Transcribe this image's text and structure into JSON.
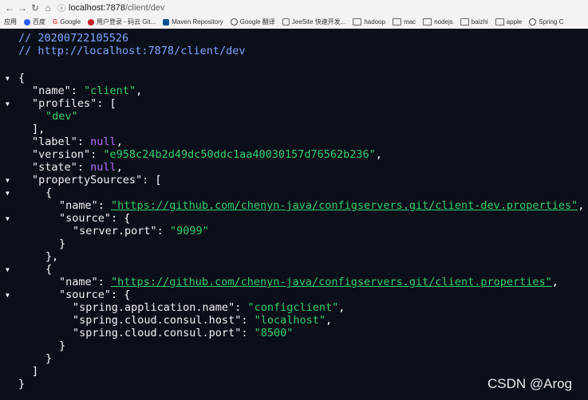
{
  "browser": {
    "url_host": "localhost:7878",
    "url_path": "/client/dev",
    "bookmarks": [
      {
        "label": "应用",
        "icon": "apps-icon"
      },
      {
        "label": "百度",
        "icon": "baidu-icon",
        "color": "#2a5cff"
      },
      {
        "label": "Google",
        "icon": "google-icon",
        "color": "#ea4335"
      },
      {
        "label": "用户登录 - 码云 Git...",
        "icon": "gitee-icon",
        "color": "#c71d23"
      },
      {
        "label": "Maven Repository",
        "icon": "maven-icon",
        "color": "#0b5394"
      },
      {
        "label": "Google 翻译",
        "icon": "translate-icon",
        "color": "#444444"
      },
      {
        "label": "JeeSite 快速开发...",
        "icon": "jeesite-icon",
        "color": "#666666"
      },
      {
        "label": "hadoop",
        "icon": "folder-icon"
      },
      {
        "label": "mac",
        "icon": "folder-icon"
      },
      {
        "label": "nodejs",
        "icon": "folder-icon"
      },
      {
        "label": "baizhi",
        "icon": "folder-icon"
      },
      {
        "label": "apple",
        "icon": "folder-icon"
      },
      {
        "label": "Spring C",
        "icon": "spring-icon",
        "color": "#444444"
      }
    ]
  },
  "json_view": {
    "comment_timestamp": "// 20200722105526",
    "comment_url": "// http://localhost:7878/client/dev",
    "name_value": "\"client\"",
    "profiles_0": "\"dev\"",
    "label_value": "null",
    "version_value": "\"e958c24b2d49dc50ddc1aa40030157d76562b236\"",
    "state_value": "null",
    "ps0_name": "\"https://github.com/chenyn-java/configservers.git/client-dev.properties\"",
    "ps0_key": "\"server.port\"",
    "ps0_val": "\"9099\"",
    "ps1_name": "\"https://github.com/chenyn-java/configservers.git/client.properties\"",
    "ps1_k1": "\"spring.application.name\"",
    "ps1_v1": "\"configclient\"",
    "ps1_k2": "\"spring.cloud.consul.host\"",
    "ps1_v2": "\"localhost\"",
    "ps1_k3": "\"spring.cloud.consul.port\"",
    "ps1_v3": "\"8500\""
  },
  "watermark": "CSDN @Arog",
  "colors": {
    "background": "#0b0f1a",
    "string": "#2fd16b",
    "null": "#b66dff",
    "comment": "#7ea6ff"
  }
}
